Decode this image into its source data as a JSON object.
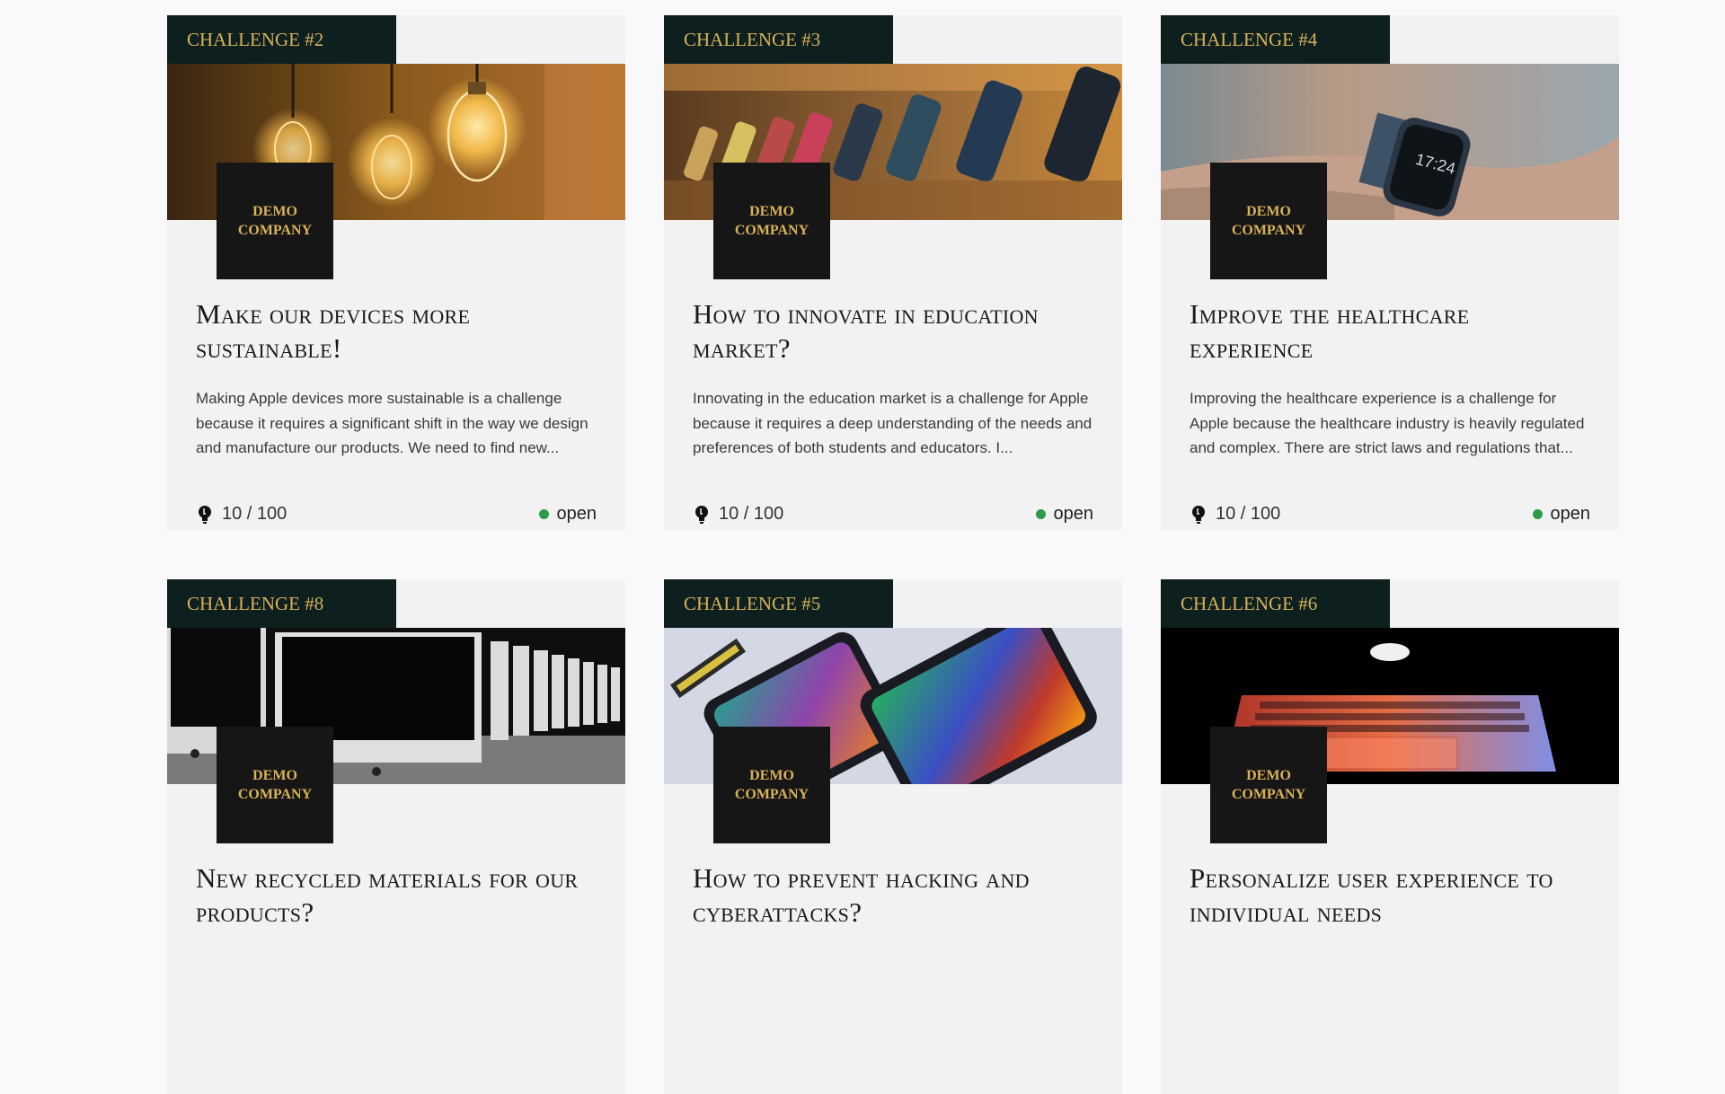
{
  "cards": [
    {
      "challenge": "CHALLENGE #2",
      "company_line1": "DEMO",
      "company_line2": "COMPANY",
      "title": "Make our devices more sustainable!",
      "description": "Making Apple devices more sustainable is a challenge because it requires a significant shift in the way we design and manufacture our products. We need to find new...",
      "ideas": "10 / 100",
      "status": "open",
      "image": "light-bulbs"
    },
    {
      "challenge": "CHALLENGE #3",
      "company_line1": "DEMO",
      "company_line2": "COMPANY",
      "title": "How to innovate in education market?",
      "description": "Innovating in the education market is a challenge for Apple because it requires a deep understanding of the needs and preferences of both students and educators. I...",
      "ideas": "10 / 100",
      "status": "open",
      "image": "phone-cases-wall"
    },
    {
      "challenge": "CHALLENGE #4",
      "company_line1": "DEMO",
      "company_line2": "COMPANY",
      "title": "Improve the healthcare experience",
      "description": "Improving the healthcare experience is a challenge for Apple because the healthcare industry is heavily regulated and complex. There are strict laws and regulations that...",
      "ideas": "10 / 100",
      "status": "open",
      "image": "smartwatch-wrist"
    },
    {
      "challenge": "CHALLENGE #8",
      "company_line1": "DEMO",
      "company_line2": "COMPANY",
      "title": "New recycled materials for our products?",
      "description": "",
      "ideas": "",
      "status": "",
      "image": "imac-row"
    },
    {
      "challenge": "CHALLENGE #5",
      "company_line1": "DEMO",
      "company_line2": "COMPANY",
      "title": "How to prevent hacking and cyberattacks?",
      "description": "",
      "ideas": "",
      "status": "",
      "image": "tablets-colorful"
    },
    {
      "challenge": "CHALLENGE #6",
      "company_line1": "DEMO",
      "company_line2": "COMPANY",
      "title": "Personalize user experience to individual needs",
      "description": "",
      "ideas": "",
      "status": "",
      "image": "laptop-dark-glow"
    }
  ],
  "colors": {
    "badge_bg": "#0d1f1e",
    "gold": "#d9b25a",
    "logo_bg": "#161616",
    "status_open": "#2e9b4a",
    "card_bg": "#f2f2f2"
  }
}
